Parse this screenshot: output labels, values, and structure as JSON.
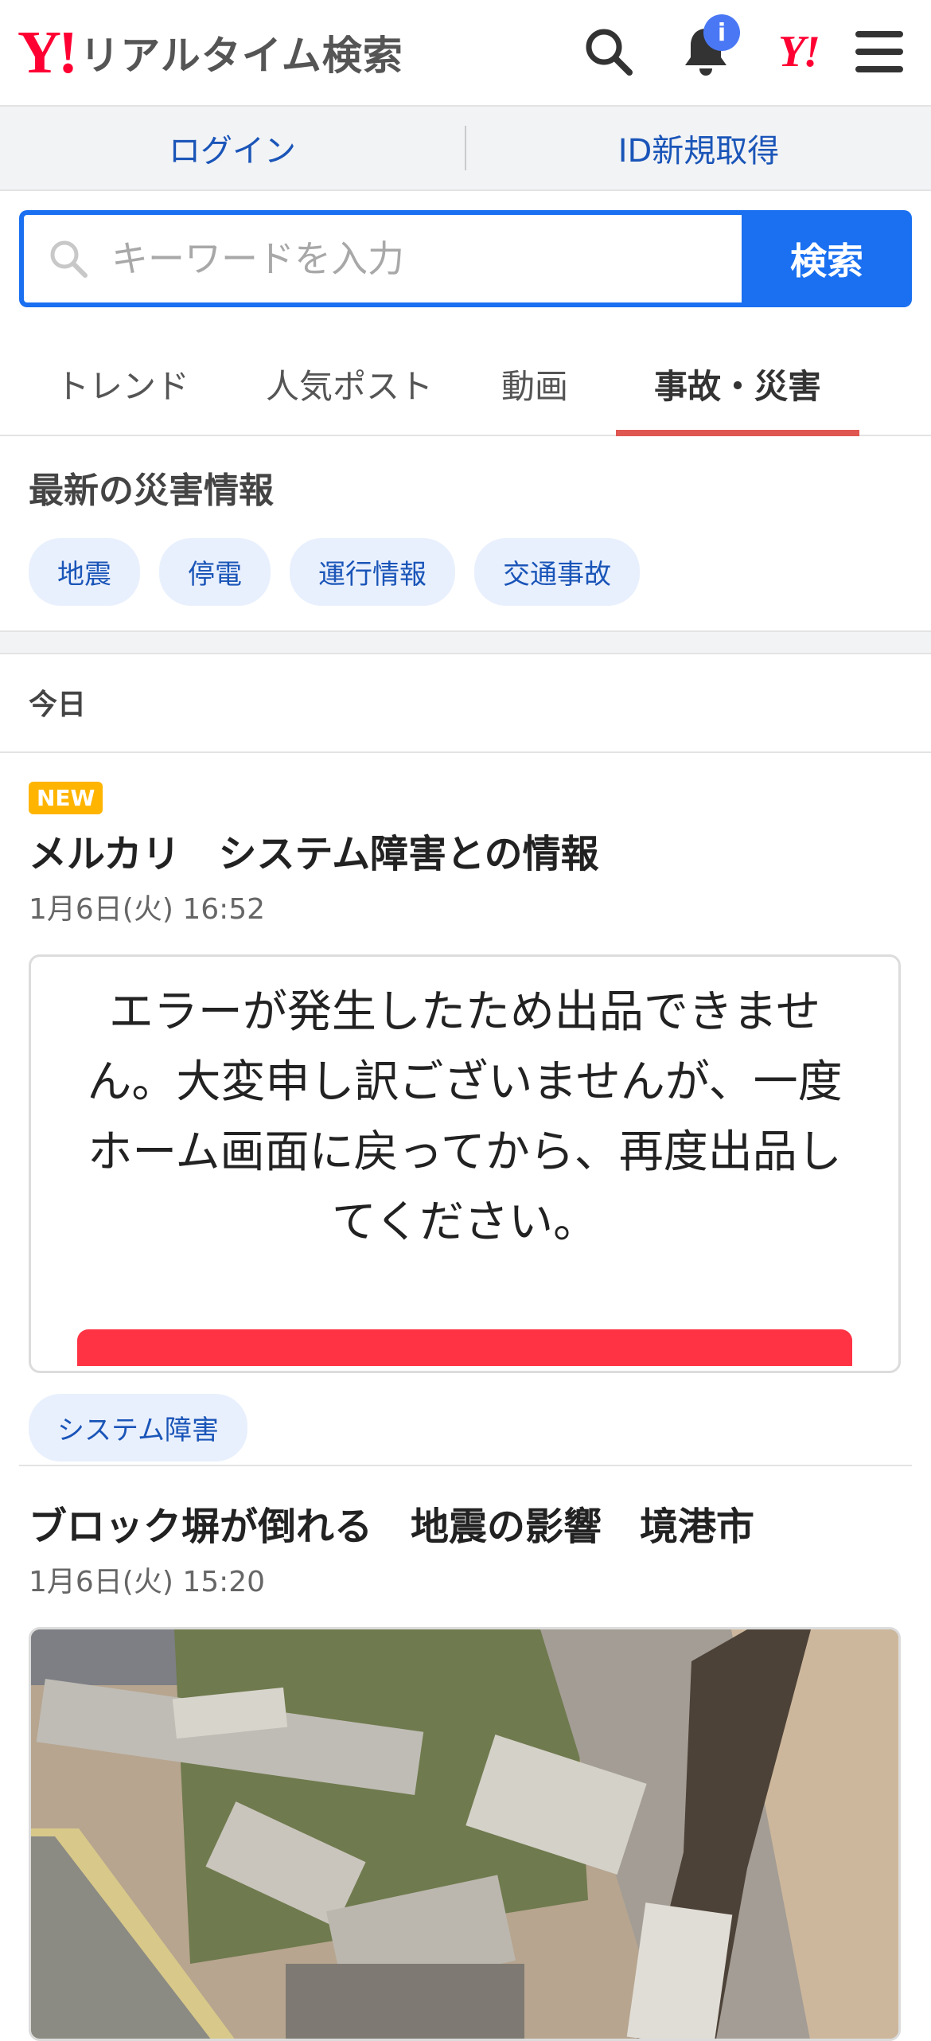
{
  "header": {
    "logo_mark": "Y!",
    "logo_text": "リアルタイム検索",
    "notification_badge": "i",
    "yahoo_mini": "Y!"
  },
  "auth": {
    "login": "ログイン",
    "register": "ID新規取得"
  },
  "search": {
    "placeholder": "キーワードを入力",
    "button": "検索"
  },
  "tabs": [
    {
      "label": "トレンド",
      "active": false
    },
    {
      "label": "人気ポスト",
      "active": false
    },
    {
      "label": "動画",
      "active": false
    },
    {
      "label": "事故・災害",
      "active": true
    }
  ],
  "disaster": {
    "title": "最新の災害情報",
    "chips": [
      "地震",
      "停電",
      "運行情報",
      "交通事故"
    ]
  },
  "day_label": "今日",
  "posts": [
    {
      "badge": "NEW",
      "title": "メルカリ　システム障害との情報",
      "time": "1月6日(火) 16:52",
      "card_text": "エラーが発生したため出品できません。大変申し訳ございませんが、一度ホーム画面に戻ってから、再度出品してください。",
      "tag": "システム障害"
    },
    {
      "title": "ブロック塀が倒れる　地震の影響　境港市",
      "time": "1月6日(火) 15:20"
    }
  ],
  "colors": {
    "brand_red": "#ff0033",
    "link_blue": "#1a55b8",
    "search_blue": "#1a70f0",
    "tab_underline": "#e05752",
    "new_badge": "#ffb400"
  }
}
